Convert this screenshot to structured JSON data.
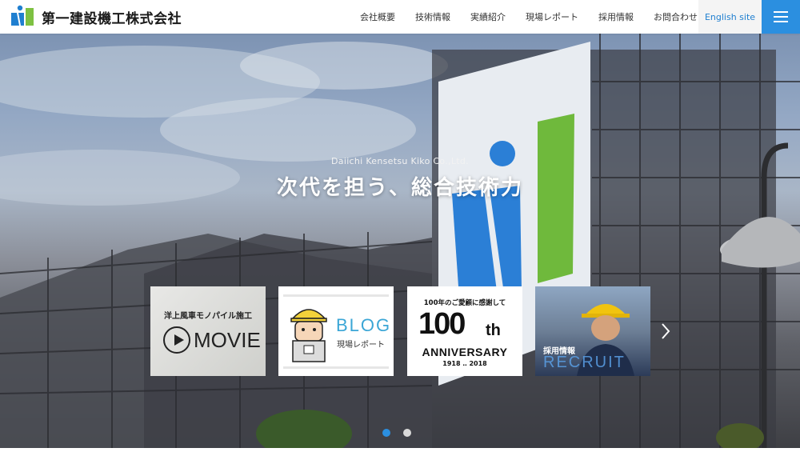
{
  "header": {
    "company_name": "第一建設機工株式会社",
    "nav": [
      "会社概要",
      "技術情報",
      "実績紹介",
      "現場レポート",
      "採用情報",
      "お問合わせ"
    ],
    "english_label": "English site",
    "menu_icon": "hamburger-icon"
  },
  "hero": {
    "subtitle": "Daiichi Kensetsu Kiko Co.,Ltd.",
    "title": "次代を担う、総合技術力",
    "scaffold_banner_text": "次代を担う、総合技術力",
    "scaffold_banner_company": "第一建設機工株式会社"
  },
  "banners": {
    "movie": {
      "top_text": "洋上風車モノパイル施工",
      "word": "MOVIE"
    },
    "blog": {
      "word": "BLOG",
      "sub": "現場レポート"
    },
    "anniversary": {
      "top_text": "100年のご愛顧に感謝して",
      "big": "100",
      "suffix": "th",
      "word": "ANNIVERSARY",
      "years": "1918 ‥ 2018"
    },
    "recruit": {
      "label": "採用情報",
      "word": "RECRUIT"
    }
  },
  "slider": {
    "active_dot": 0,
    "dot_count": 2
  },
  "colors": {
    "accent_blue": "#2b8fe0",
    "logo_blue": "#1f7fd0",
    "logo_green": "#7ec142",
    "dot_active": "#2b8fe0",
    "dot_inactive": "#d9d9d9"
  }
}
